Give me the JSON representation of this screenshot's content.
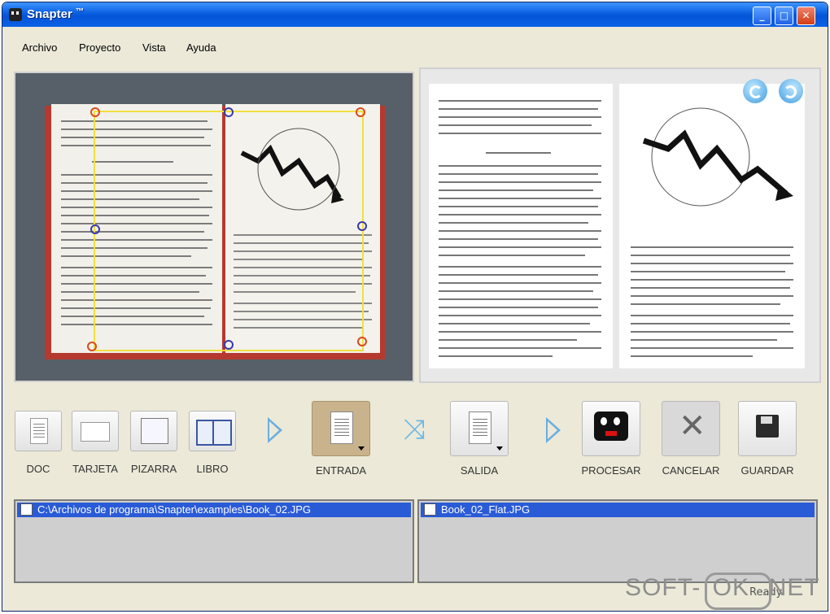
{
  "window": {
    "title": "Snapter",
    "title_mark": "™",
    "min": "_",
    "max": "□",
    "close": "✕"
  },
  "menu": [
    "Archivo",
    "Proyecto",
    "Vista",
    "Ayuda"
  ],
  "tools": [
    {
      "label": "DOC"
    },
    {
      "label": "TARJETA"
    },
    {
      "label": "PIZARRA"
    },
    {
      "label": "LIBRO"
    }
  ],
  "pipeline": {
    "input": "ENTRADA",
    "output": "SALIDA",
    "process": "PROCESAR",
    "cancel": "CANCELAR",
    "save": "GUARDAR"
  },
  "files": {
    "input": "C:\\Archivos de programa\\Snapter\\examples\\Book_02.JPG",
    "output": "Book_02_Flat.JPG"
  },
  "status": "Ready",
  "watermark": {
    "left": "SOFT-",
    "box": "OK",
    "right": ".NET"
  },
  "colors": {
    "title": "#0a5fe0",
    "selection": "#2a5bd7",
    "handle_corner": "#d64b1c",
    "handle_mid": "#3a3aa8"
  }
}
